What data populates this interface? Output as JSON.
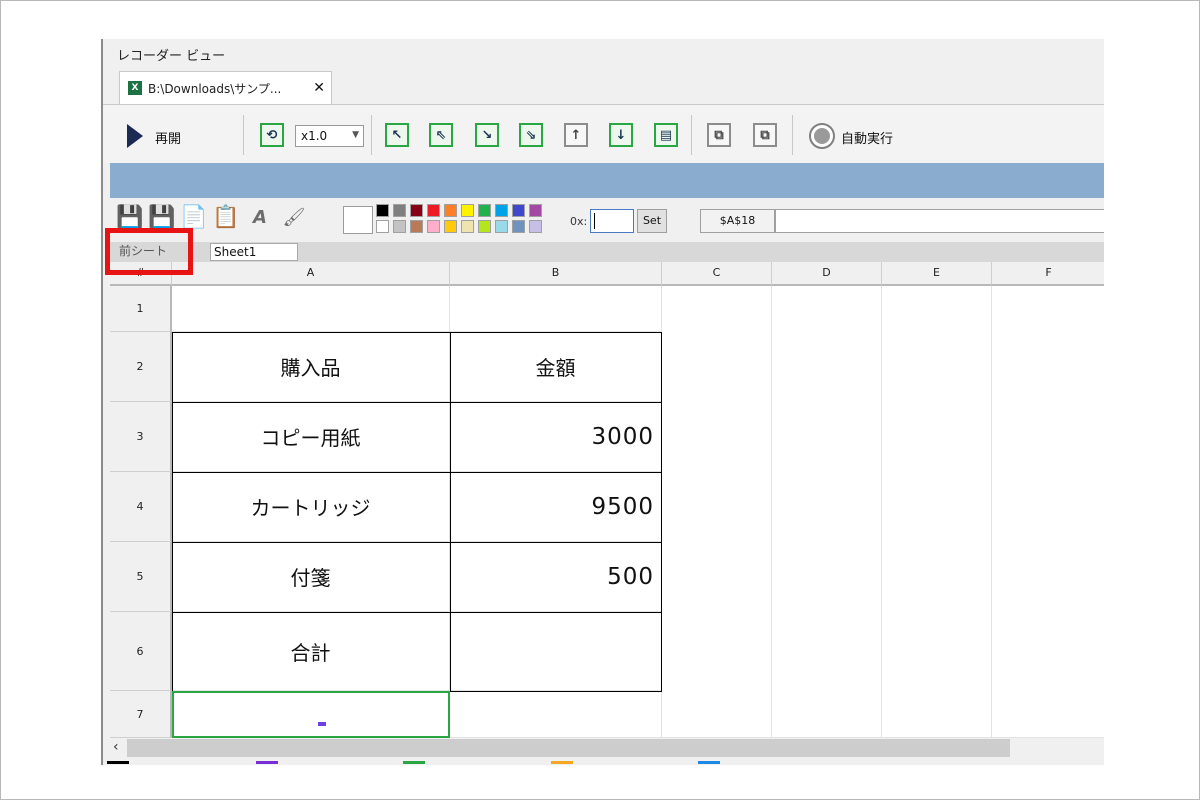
{
  "window": {
    "title": "レコーダー ビュー"
  },
  "tab": {
    "icon": "X",
    "label": "B:\\Downloads\\サンプ...",
    "close": "✕"
  },
  "toolbar": {
    "resume_label": "再開",
    "speed": {
      "value": "x1.0",
      "arrow": "▼"
    },
    "nav_icons": [
      "↖",
      "⇖",
      "↘",
      "⇘",
      "↑",
      "↓",
      "▤"
    ],
    "window_icons": [
      "⧉",
      "⧉"
    ],
    "auto_run_label": "自動実行"
  },
  "edit_bar": {
    "tools": [
      "💾",
      "💾",
      "📄",
      "📋",
      "A",
      "🖌"
    ],
    "palette_top": [
      "#000000",
      "#7f7f7f",
      "#880015",
      "#ed1c24",
      "#ff7f27",
      "#fff200",
      "#22b14c",
      "#00a2e8",
      "#3f48cc",
      "#a349a4"
    ],
    "palette_bottom": [
      "#ffffff",
      "#c3c3c3",
      "#b97a57",
      "#ffaec9",
      "#ffc90e",
      "#efe4b0",
      "#b5e61d",
      "#99d9ea",
      "#7092be",
      "#c8bfe7"
    ],
    "ox_label": "0x:",
    "set_label": "Set",
    "cell_ref": "$A$18"
  },
  "sheet_bar": {
    "prev_sheet": "前シート",
    "sheet_name": "Sheet1"
  },
  "grid": {
    "corner": "#",
    "columns": [
      "A",
      "B",
      "C",
      "D",
      "E",
      "F"
    ],
    "rows": [
      "1",
      "2",
      "3",
      "4",
      "5",
      "6",
      "7"
    ],
    "header": {
      "item": "購入品",
      "amount": "金額"
    },
    "items": [
      {
        "name": "コピー用紙",
        "amount": "3000"
      },
      {
        "name": "カートリッジ",
        "amount": "9500"
      },
      {
        "name": "付箋",
        "amount": "500"
      }
    ],
    "total_label": "合計"
  },
  "colors": {
    "selection": "#2aa642",
    "highlight": "#e81414",
    "banner": "#8aaccf"
  },
  "bottom_tab_colors": [
    "#000000",
    "#7a2fd6",
    "#2aa642",
    "#f5a623",
    "#1e88e5"
  ]
}
